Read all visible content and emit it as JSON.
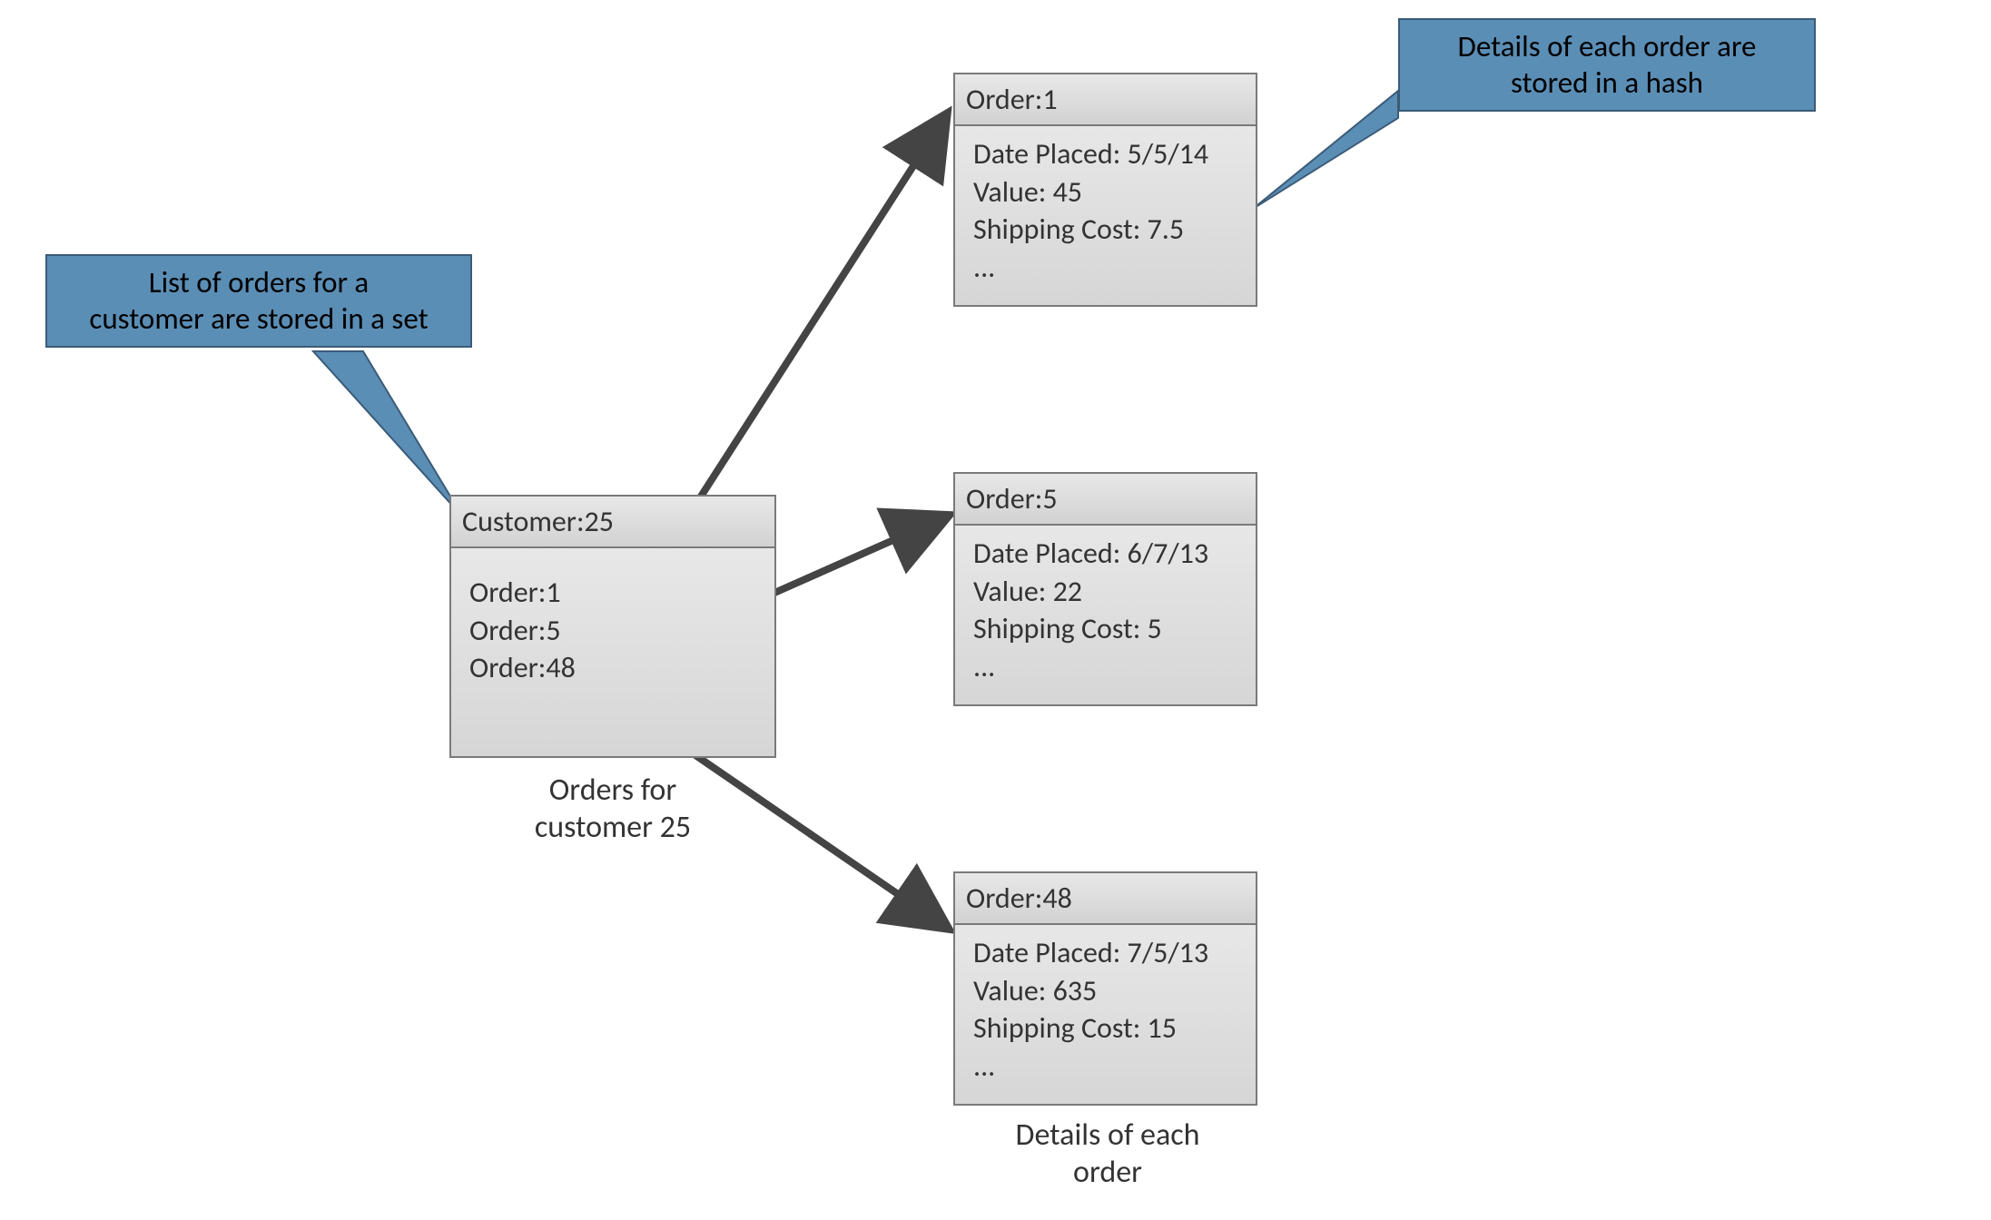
{
  "callouts": {
    "left": {
      "line1": "List of orders for a",
      "line2": "customer are stored in a set"
    },
    "right": {
      "line1": "Details of each order are",
      "line2": "stored in a hash"
    }
  },
  "customerBox": {
    "header": "Customer:25",
    "items": [
      "Order:1",
      "Order:5",
      "Order:48"
    ]
  },
  "captions": {
    "customer": {
      "line1": "Orders for",
      "line2": "customer 25"
    },
    "orders": {
      "line1": "Details of each",
      "line2": "order"
    }
  },
  "orders": [
    {
      "header": "Order:1",
      "fields": {
        "date": "Date Placed: 5/5/14",
        "value": "Value: 45",
        "ship": "Shipping Cost: 7.5",
        "more": "..."
      }
    },
    {
      "header": "Order:5",
      "fields": {
        "date": "Date Placed: 6/7/13",
        "value": "Value: 22",
        "ship": "Shipping Cost: 5",
        "more": "..."
      }
    },
    {
      "header": "Order:48",
      "fields": {
        "date": "Date Placed: 7/5/13",
        "value": "Value: 635",
        "ship": "Shipping Cost: 15",
        "more": "..."
      }
    }
  ]
}
